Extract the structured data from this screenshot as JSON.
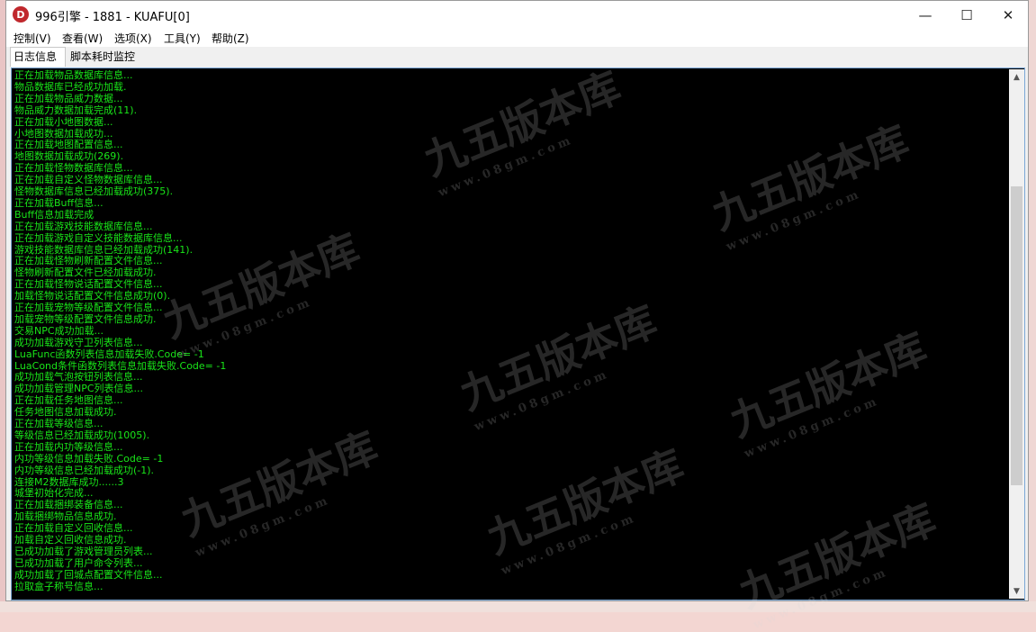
{
  "window": {
    "title": "996引擎 - 1881 - KUAFU[0]",
    "icon_letter": "D",
    "minimize_glyph": "—",
    "maximize_glyph": "☐",
    "close_glyph": "✕"
  },
  "menu": [
    {
      "label": "控制(V)"
    },
    {
      "label": "查看(W)"
    },
    {
      "label": "选项(X)"
    },
    {
      "label": "工具(Y)"
    },
    {
      "label": "帮助(Z)"
    }
  ],
  "tabs": [
    {
      "label": "日志信息",
      "active": true
    },
    {
      "label": "脚本耗时监控",
      "active": false
    }
  ],
  "log": [
    "正在加载物品数据库信息...",
    "物品数据库已经成功加载.",
    "正在加载物品威力数据...",
    "物品威力数据加载完成(11).",
    "正在加载小地图数据...",
    "小地图数据加载成功...",
    "正在加载地图配置信息...",
    "地图数据加载成功(269).",
    "正在加载怪物数据库信息...",
    "正在加载自定义怪物数据库信息...",
    "怪物数据库信息已经加载成功(375).",
    "正在加载Buff信息...",
    "Buff信息加载完成",
    "正在加载游戏技能数据库信息...",
    "正在加载游戏自定义技能数据库信息...",
    "游戏技能数据库信息已经加载成功(141).",
    "正在加载怪物刷新配置文件信息...",
    "怪物刷新配置文件已经加载成功.",
    "正在加载怪物说话配置文件信息...",
    "加载怪物说话配置文件信息成功(0).",
    "正在加载宠物等级配置文件信息...",
    "加载宠物等级配置文件信息成功.",
    "交易NPC成功加载...",
    "成功加载游戏守卫列表信息...",
    "LuaFunc函数列表信息加载失败.Code= -1",
    "LuaCond条件函数列表信息加载失败.Code= -1",
    "成功加载气泡按钮列表信息...",
    "成功加载管理NPC列表信息...",
    "正在加载任务地图信息...",
    "任务地图信息加载成功.",
    "正在加载等级信息...",
    "等级信息已经加载成功(1005).",
    "正在加载内功等级信息...",
    "内功等级信息加载失败.Code= -1",
    "内功等级信息已经加载成功(-1).",
    "连接M2数据库成功......3",
    "城堡初始化完成...",
    "正在加载捆绑装备信息...",
    "加载捆绑物品信息成功.",
    "正在加载自定义回收信息...",
    "加载自定义回收信息成功.",
    "已成功加载了游戏管理员列表...",
    "已成功加载了用户命令列表...",
    "成功加载了回城点配置文件信息...",
    "拉取盒子称号信息..."
  ],
  "scrollbar": {
    "up_glyph": "▲",
    "down_glyph": "▼"
  },
  "watermark": {
    "text": "九五版本库",
    "url": "www.08gm.com"
  }
}
